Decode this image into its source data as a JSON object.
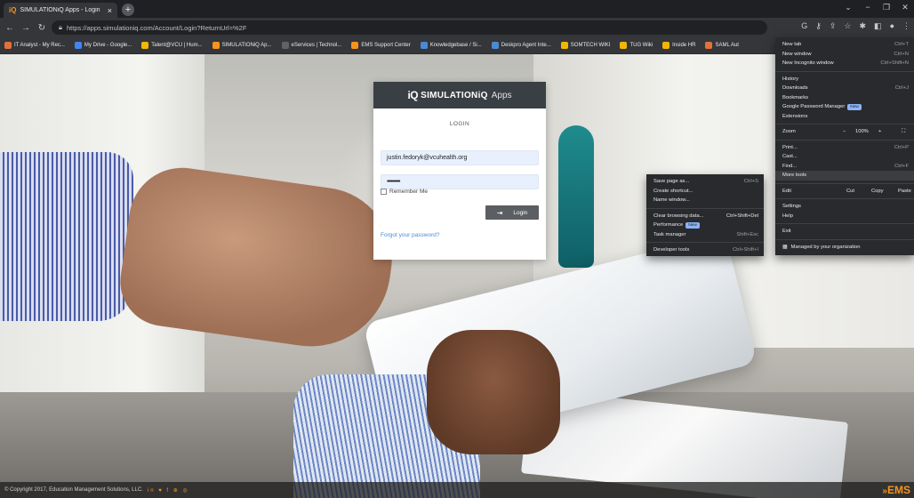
{
  "browser": {
    "tab_title": "SIMULATIONiQ Apps - Login",
    "tab_favicon": "iQ",
    "url": "https://apps.simulationiq.com/Account/Login?ReturnUrl=%2F",
    "bookmarks": [
      {
        "label": "IT Analyst - My Rec...",
        "color": "#e3713a"
      },
      {
        "label": "My Drive - Google...",
        "color": "#4285f4"
      },
      {
        "label": "Talent@VCU | Hum...",
        "color": "#f2b705"
      },
      {
        "label": "SIMULATIONiQ Ap...",
        "color": "#f7941d"
      },
      {
        "label": "eServices | Technol...",
        "color": "#5f6368"
      },
      {
        "label": "EMS Support Center",
        "color": "#f7941d"
      },
      {
        "label": "Knowledgebase / Si...",
        "color": "#4a8ad4"
      },
      {
        "label": "Deskpro Agent Inte...",
        "color": "#4a8ad4"
      },
      {
        "label": "SOMTECH WIKI",
        "color": "#f2b705"
      },
      {
        "label": "TUG Wiki",
        "color": "#f2b705"
      },
      {
        "label": "Inside HR",
        "color": "#f2b705"
      },
      {
        "label": "SAML Aut",
        "color": "#e3713a"
      }
    ]
  },
  "login": {
    "logo_iq": "iQ",
    "logo_name": "SIMULATIONiQ",
    "logo_apps": "Apps",
    "title": "LOGIN",
    "username_value": "justin.fedoryk@vcuhealth.org",
    "password_value": "••••••••••",
    "remember_label": "Remember Me",
    "login_button": "Login",
    "forgot_link": "Forgot your password?"
  },
  "footer": {
    "copyright": "© Copyright 2017, Education Management Solutions, LLC.",
    "social": "in ♥ f ⊕ ◎",
    "brand": "EMS"
  },
  "main_menu": {
    "new_tab": "New tab",
    "new_tab_sc": "Ctrl+T",
    "new_window": "New window",
    "new_window_sc": "Ctrl+N",
    "new_incognito": "New Incognito window",
    "new_incognito_sc": "Ctrl+Shift+N",
    "history": "History",
    "downloads": "Downloads",
    "downloads_sc": "Ctrl+J",
    "bookmarks": "Bookmarks",
    "password_manager": "Google Password Manager",
    "password_badge": "New",
    "extensions": "Extensions",
    "zoom": "Zoom",
    "zoom_minus": "−",
    "zoom_value": "100%",
    "zoom_plus": "+",
    "print": "Print...",
    "print_sc": "Ctrl+P",
    "cast": "Cast...",
    "find": "Find...",
    "find_sc": "Ctrl+F",
    "more_tools": "More tools",
    "edit": "Edit",
    "cut": "Cut",
    "copy": "Copy",
    "paste": "Paste",
    "settings": "Settings",
    "help": "Help",
    "exit": "Exit",
    "managed": "Managed by your organization"
  },
  "sub_menu": {
    "save_page": "Save page as...",
    "save_page_sc": "Ctrl+S",
    "create_shortcut": "Create shortcut...",
    "name_window": "Name window...",
    "clear_data": "Clear browsing data...",
    "clear_data_sc": "Ctrl+Shift+Del",
    "performance": "Performance",
    "performance_badge": "New",
    "task_manager": "Task manager",
    "task_manager_sc": "Shift+Esc",
    "dev_tools": "Developer tools",
    "dev_tools_sc": "Ctrl+Shift+I"
  }
}
